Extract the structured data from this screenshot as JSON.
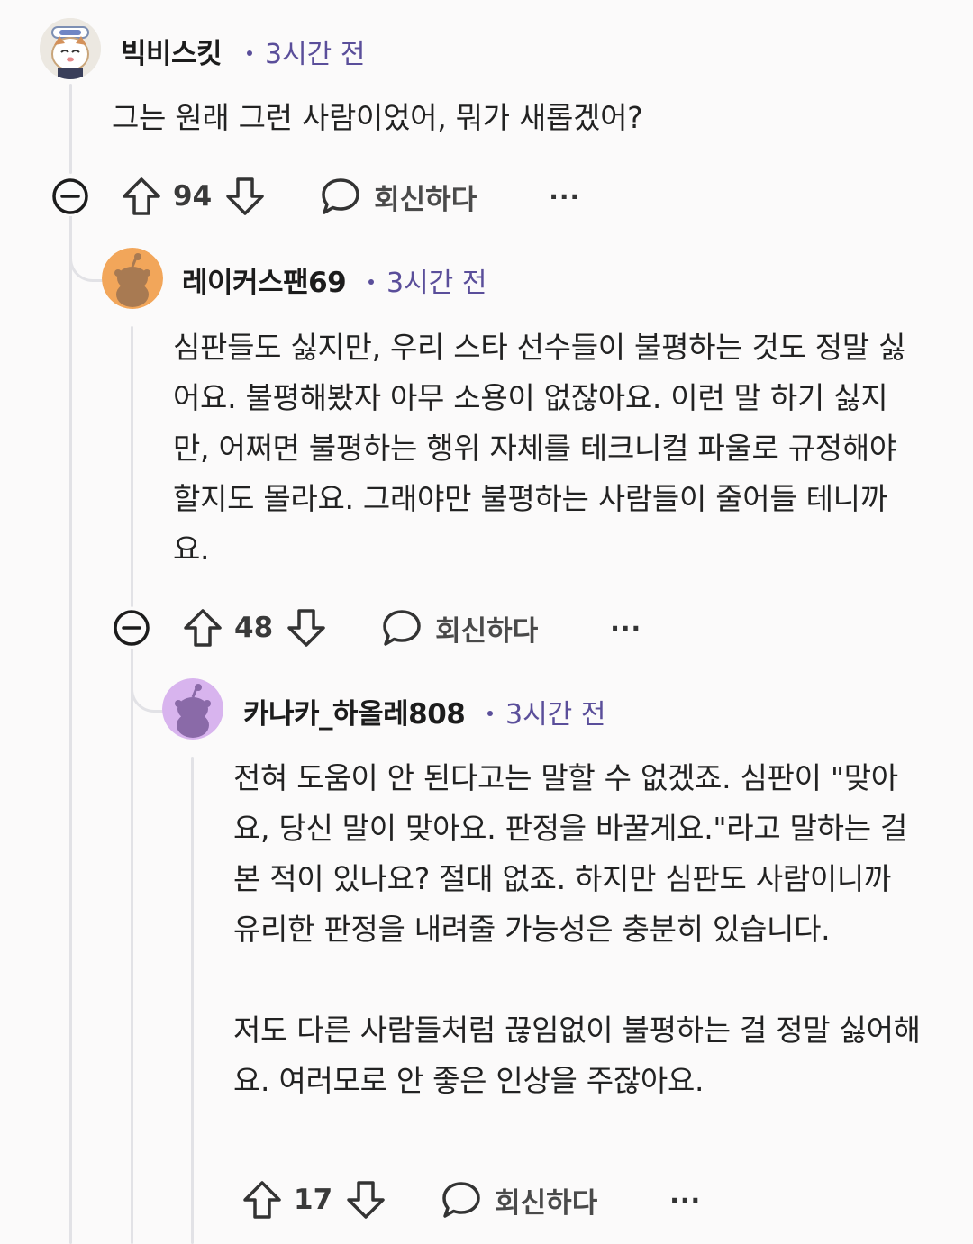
{
  "comments": [
    {
      "author": "빅비스킷",
      "time": "3시간 전",
      "paragraphs": [
        "그는 원래 그런 사람이었어, 뭐가 새롭겠어?"
      ],
      "votes": "94",
      "reply_label": "회신하다",
      "more_label": "···"
    },
    {
      "author": "레이커스팬69",
      "time": "3시간 전",
      "paragraphs": [
        "심판들도 싫지만, 우리 스타 선수들이 불평하는 것도 정말 싫어요. 불평해봤자 아무 소용이 없잖아요. 이런 말 하기 싫지만, 어쩌면 불평하는 행위 자체를 테크니컬 파울로 규정해야 할지도 몰라요. 그래야만 불평하는 사람들이 줄어들 테니까요."
      ],
      "votes": "48",
      "reply_label": "회신하다",
      "more_label": "···"
    },
    {
      "author": "카나카_하올레808",
      "time": "3시간 전",
      "paragraphs": [
        "전혀 도움이 안 된다고는 말할 수 없겠죠. 심판이 \"맞아요, 당신 말이 맞아요. 판정을 바꿀게요.\"라고 말하는 걸 본 적이 있나요? 절대 없죠. 하지만 심판도 사람이니까 유리한 판정을 내려줄 가능성은 충분히 있습니다.",
        "저도 다른 사람들처럼 끊임없이 불평하는 걸 정말 싫어해요. 여러모로 안 좋은 인상을 주잖아요."
      ],
      "votes": "17",
      "reply_label": "회신하다",
      "more_label": "···"
    }
  ],
  "icons": {
    "collapse": "minus-circle-icon",
    "upvote": "arrow-up-icon",
    "downvote": "arrow-down-icon",
    "reply": "speech-bubble-icon",
    "more": "ellipsis-icon"
  },
  "colors": {
    "meta_time": "#5a4e9a",
    "avatar2_bg": "#f2a65a",
    "avatar3_bg": "#d8b4ee",
    "thread_line": "#e2e2e6"
  }
}
